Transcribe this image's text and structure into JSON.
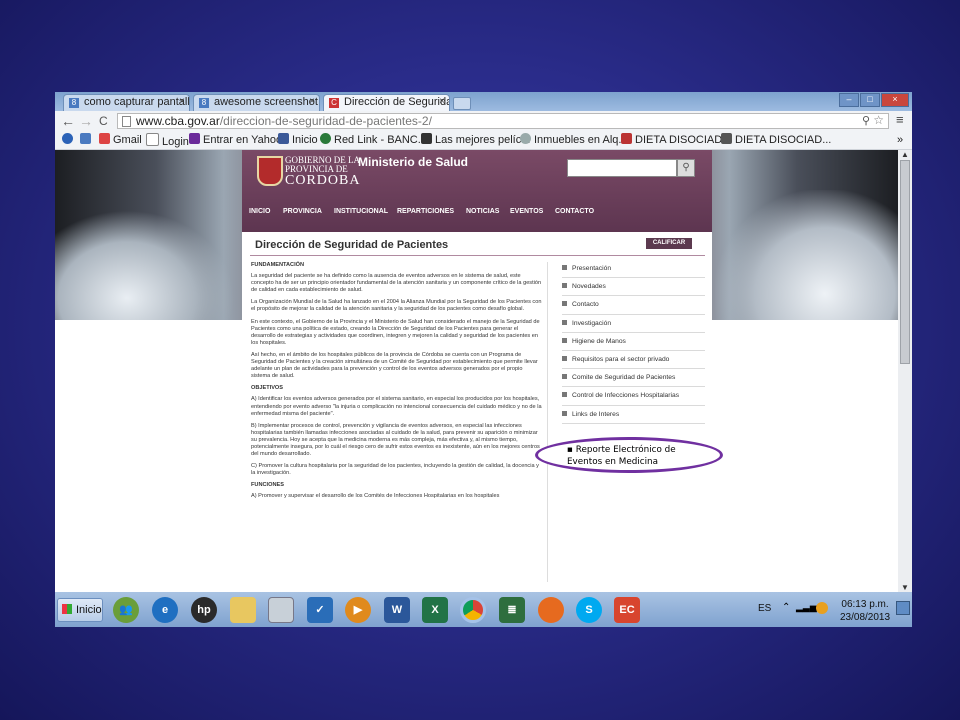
{
  "browser": {
    "tabs": [
      {
        "label": "como capturar pantall",
        "favicon": "8"
      },
      {
        "label": "awesome screenshot c",
        "favicon": "8"
      },
      {
        "label": "Dirección de Segurida",
        "favicon": "C",
        "active": true
      }
    ],
    "url_host": "www.cba.gov.ar",
    "url_path": "/direccion-de-seguridad-de-pacientes-2/",
    "back_glyph": "←",
    "forward_glyph": "→",
    "reload_glyph": "C",
    "menu_glyph": "≡",
    "bookmarks": [
      "Gmail",
      "Login",
      "Entrar en Yahoo!",
      "Inicio",
      "Red Link - BANC...",
      "Las mejores pelíc...",
      "Inmuebles en Alq...",
      "DIETA DISOCIAD...",
      "DIETA DISOCIAD..."
    ],
    "bookmarks_more": "»"
  },
  "site": {
    "logo_line1": "GOBIERNO DE LA",
    "logo_line2": "PROVINCIA DE",
    "logo_line3": "CORDOBA",
    "ministry": "Ministerio de Salud",
    "nav": [
      "INICIO",
      "PROVINCIA",
      "INSTITUCIONAL",
      "REPARTICIONES",
      "NOTICIAS",
      "EVENTOS",
      "CONTACTO"
    ],
    "page_title": "Dirección de Seguridad de Pacientes",
    "rate_button": "CALIFICAR",
    "sections": {
      "fundamentacion_heading": "FUNDAMENTACIÓN",
      "fundamentacion_p1": "La seguridad del paciente se ha definido como la ausencia de eventos adversos en le sistema de salud, este concepto ha de ser un principio orientador fundamental de la atención sanitaria y un componente crítico de la gestión de calidad en cada establecimiento de salud.",
      "fundamentacion_p2": "La Organización Mundial de la Salud ha lanzado en el 2004 la Alianza Mundial por la Seguridad de los Pacientes con el propósito de mejorar la calidad de la atención sanitaria y la seguridad de los pacientes como desafío global.",
      "fundamentacion_p3": "En este contexto, el Gobierno de la Provincia y el Ministerio de Salud han considerado el manejo de la Seguridad de Pacientes como una política de estado, creando la Dirección de Seguridad de los Pacientes para generar el desarrollo de estrategias y actividades que coordinen, integren y mejoren la calidad y seguridad de los pacientes en los hospitales.",
      "fundamentacion_p4": "Así hecho, en el ámbito de los hospitales públicos de la provincia de Córdoba se cuenta con un Programa de Seguridad de Pacientes y la creación simultánea de un Comité de Seguridad por establecimiento que permite llevar adelante un plan de actividades para la prevención y control de los eventos adversos generados por el propio sistema de salud.",
      "objetivos_heading": "OBJETIVOS",
      "objetivos_a": "A) Identificar los eventos adversos generados por el sistema sanitario, en especial los producidos por los hospitales, entendiendo por evento adverso \"la injuria o complicación no intencional consecuencia del cuidado médico y no de la enfermedad misma del paciente\".",
      "objetivos_b": "B) Implementar procesos de control, prevención y vigilancia de eventos adversos, en especial las infecciones hospitalarias también llamadas infecciones asociadas al cuidado de la salud, para prevenir su aparición o minimizar su prevalencia. Hoy se acepta que la medicina moderna es más compleja, más efectiva y, al mismo tiempo, potencialmente insegura, por lo cuál el riesgo cero de sufrir estos eventos es inexistente, aún en los mejores centros del mundo desarrollado.",
      "objetivos_c": "C) Promover la cultura hospitalaria por la seguridad de los pacientes, incluyendo la gestión de calidad, la docencia y la investigación.",
      "funciones_heading": "FUNCIONES",
      "funciones_a": "A) Promover y supervisar el desarrollo de los Comités de Infecciones Hospitalarias en los hospitales"
    },
    "side_menu": [
      "Presentación",
      "Novedades",
      "Contacto",
      "Investigación",
      "Higiene de Manos",
      "Requisitos para el sector privado",
      "Comite de Seguridad de Pacientes",
      "Control de Infecciones Hospitalarias",
      "Links de Interes"
    ]
  },
  "annotation": {
    "text": "▪ Reporte Electrónico de Eventos en Medicina",
    "color": "#7030a0"
  },
  "taskbar": {
    "start_label": "Inicio",
    "language": "ES",
    "time": "06:13 p.m.",
    "date": "23/08/2013",
    "pinned": [
      "users-icon",
      "ie-icon",
      "hp-icon",
      "folder-icon",
      "calculator-icon",
      "chart-icon",
      "media-icon",
      "word-icon",
      "excel-icon",
      "chrome-icon",
      "document-icon",
      "firefox-icon",
      "skype-icon",
      "ec-icon"
    ]
  }
}
